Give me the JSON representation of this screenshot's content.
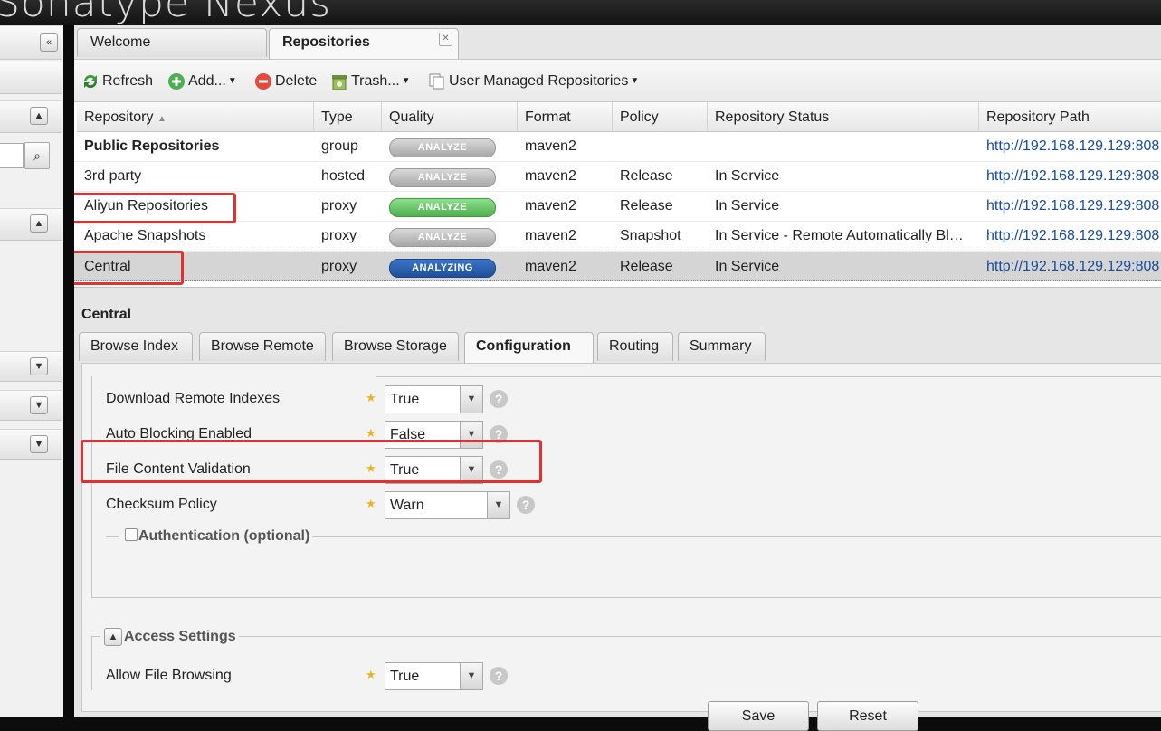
{
  "header": {
    "title": "Sonatype Nexus"
  },
  "tabs": [
    {
      "label": "Welcome"
    },
    {
      "label": "Repositories"
    }
  ],
  "toolbar": {
    "refresh": "Refresh",
    "add": "Add...",
    "delete": "Delete",
    "trash": "Trash...",
    "user_managed": "User Managed Repositories"
  },
  "grid": {
    "columns": [
      "Repository",
      "Type",
      "Quality",
      "Format",
      "Policy",
      "Repository Status",
      "Repository Path"
    ],
    "rows": [
      {
        "name": "Public Repositories",
        "type": "group",
        "quality": "ANALYZE",
        "format": "maven2",
        "policy": "",
        "status": "",
        "path": "http://192.168.129.129:808"
      },
      {
        "name": "3rd party",
        "type": "hosted",
        "quality": "ANALYZE",
        "format": "maven2",
        "policy": "Release",
        "status": "In Service",
        "path": "http://192.168.129.129:808"
      },
      {
        "name": "Aliyun Repositories",
        "type": "proxy",
        "quality": "ANALYZE",
        "format": "maven2",
        "policy": "Release",
        "status": "In Service",
        "path": "http://192.168.129.129:808"
      },
      {
        "name": "Apache Snapshots",
        "type": "proxy",
        "quality": "ANALYZE",
        "format": "maven2",
        "policy": "Snapshot",
        "status": "In Service - Remote Automatically Bl…",
        "path": "http://192.168.129.129:808"
      },
      {
        "name": "Central",
        "type": "proxy",
        "quality": "ANALYZING",
        "format": "maven2",
        "policy": "Release",
        "status": "In Service",
        "path": "http://192.168.129.129:808"
      }
    ]
  },
  "detail": {
    "title": "Central",
    "tabs": [
      "Browse Index",
      "Browse Remote",
      "Browse Storage",
      "Configuration",
      "Routing",
      "Summary"
    ],
    "fields": {
      "download_remote_indexes": {
        "label": "Download Remote Indexes",
        "value": "True"
      },
      "auto_blocking": {
        "label": "Auto Blocking Enabled",
        "value": "False"
      },
      "file_content_validation": {
        "label": "File Content Validation",
        "value": "True"
      },
      "checksum_policy": {
        "label": "Checksum Policy",
        "value": "Warn"
      },
      "allow_file_browsing": {
        "label": "Allow File Browsing",
        "value": "True"
      }
    },
    "authentication_legend": "Authentication (optional)",
    "access_legend": "Access Settings",
    "save": "Save",
    "reset": "Reset"
  },
  "colors": {
    "highlight": "#e53030",
    "analyze_green": "#5cb85c",
    "analyzing_blue": "#2a5daa"
  }
}
